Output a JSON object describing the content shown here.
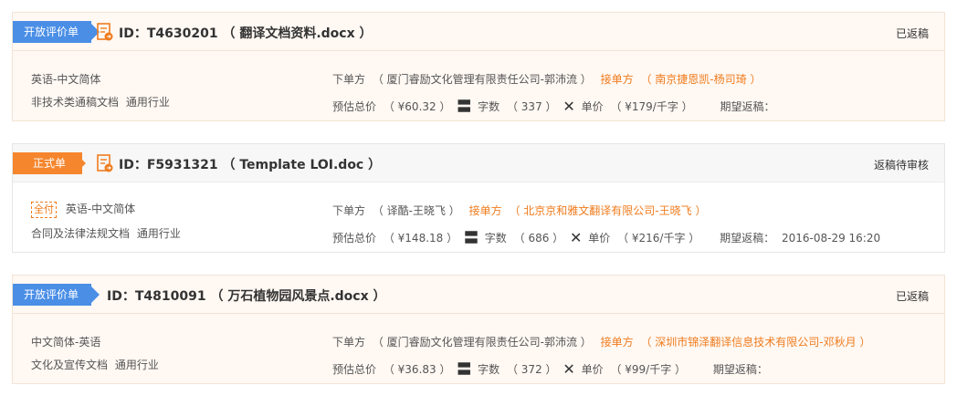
{
  "orders": [
    {
      "ribbon": "开放评价单",
      "id_label": "ID：T4630201",
      "filename": "（ 翻译文档资料.docx ）",
      "status": "已返稿",
      "lang": "英语-中文简体",
      "category": "非技术类通稿文档",
      "industry": "通用行业",
      "placer_label": "下单方",
      "placer": "（ 厦门睿励文化管理有限责任公司-郭沛流 ）",
      "receiver_label": "接单方",
      "receiver": "（ 南京捷恩凯-杨司琦 ）",
      "est_total_label": "预估总价",
      "est_total": "（ ¥60.32 ）",
      "words_label": "字数",
      "words": "（ 337 ）",
      "unit_price_label": "单价",
      "unit_price": "（ ¥179/千字 ）",
      "deadline_label": "期望返稿：",
      "deadline": ""
    },
    {
      "ribbon": "正式单",
      "id_label": "ID：F5931321",
      "filename": "（ Template LOI.doc ）",
      "status": "返稿待审核",
      "badge": "全付",
      "lang": "英语-中文简体",
      "category": "合同及法律法规文档",
      "industry": "通用行业",
      "placer_label": "下单方",
      "placer": "（ 译酷-王晓飞 ）",
      "receiver_label": "接单方",
      "receiver": "（ 北京京和雅文翻译有限公司-王晓飞 ）",
      "est_total_label": "预估总价",
      "est_total": "（ ¥148.18 ）",
      "words_label": "字数",
      "words": "（ 686 ）",
      "unit_price_label": "单价",
      "unit_price": "（ ¥216/千字 ）",
      "deadline_label": "期望返稿：",
      "deadline": "2016-08-29 16:20"
    },
    {
      "ribbon": "开放评价单",
      "id_label": "ID：T4810091",
      "filename": "（ 万石植物园风景点.docx ）",
      "status": "已返稿",
      "lang": "中文简体-英语",
      "category": "文化及宣传文档",
      "industry": "通用行业",
      "placer_label": "下单方",
      "placer": "（ 厦门睿励文化管理有限责任公司-郭沛流 ）",
      "receiver_label": "接单方",
      "receiver": "（ 深圳市锦泽翻译信息技术有限公司-邓秋月 ）",
      "est_total_label": "预估总价",
      "est_total": "（ ¥36.83 ）",
      "words_label": "字数",
      "words": "（ 372 ）",
      "unit_price_label": "单价",
      "unit_price": "（ ¥99/千字 ）",
      "deadline_label": "期望返稿：",
      "deadline": ""
    }
  ],
  "colors": {
    "ribbon_blue": "#4a8ee6",
    "ribbon_orange": "#f5862d",
    "accent_orange": "#f07c1e"
  },
  "symbols": {
    "equals": "〓",
    "times": "✕"
  }
}
